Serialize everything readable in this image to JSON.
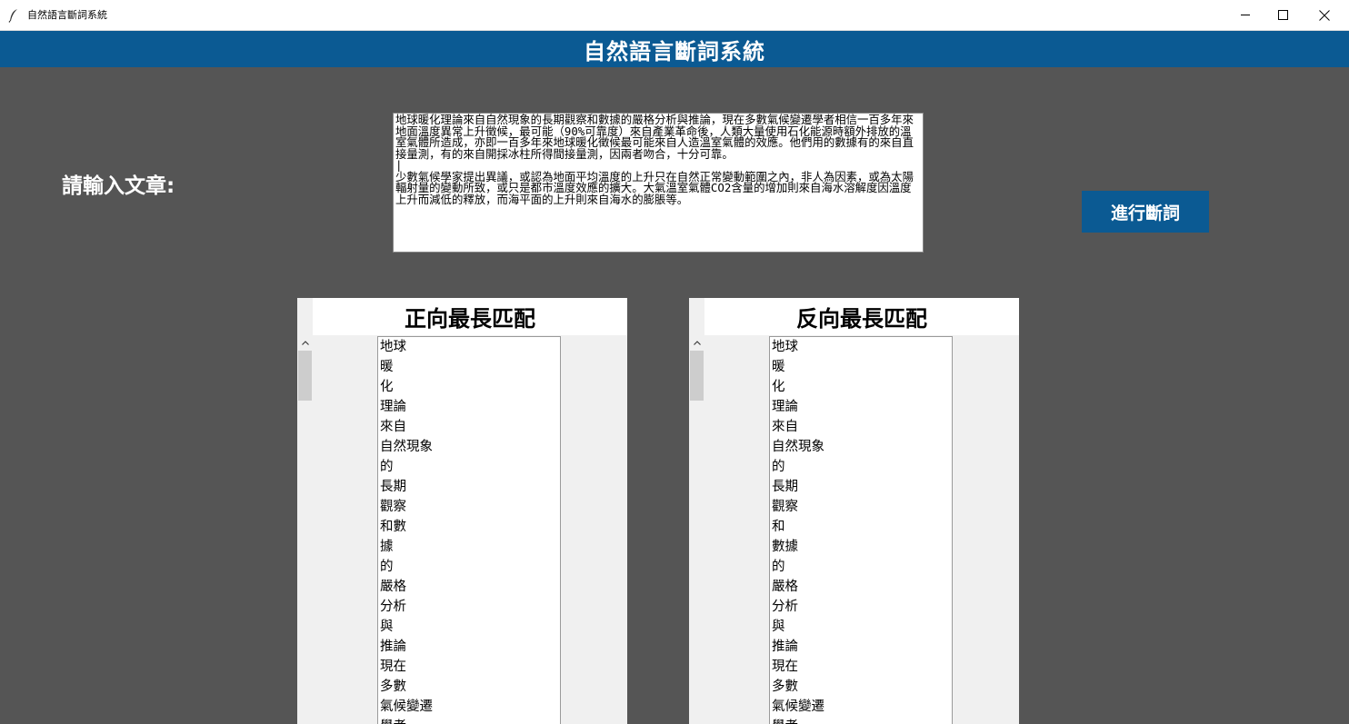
{
  "window": {
    "title": "自然語言斷詞系統"
  },
  "banner": {
    "title": "自然語言斷詞系統"
  },
  "input": {
    "label": "請輸入文章:",
    "paragraphs": [
      "地球暖化理論來自自然現象的長期觀察和數據的嚴格分析與推論，現在多數氣候變遷學者相信一百多年來地面溫度異常上升徵候，最可能（90%可靠度）來自產業革命後，人類大量使用石化能源時額外排放的溫室氣體所造成，亦即一百多年來地球暖化徵候最可能來自人造溫室氣體的效應。他們用的數據有的來自直接量測，有的來自開採冰柱所得間接量測，因兩者吻合，十分可靠。",
      "少數氣候學家提出異議，或認為地面平均溫度的上升只在自然正常變動範圍之內，非人為因素，或為太陽輻射量的變動所致，或只是都市溫度效應的擴大。大氣溫室氣體CO2含量的增加則來自海水溶解度因溫度上升而減低的釋放，而海平面的上升則來自海水的膨脹等。"
    ]
  },
  "actions": {
    "segment_label": "進行斷詞"
  },
  "forward": {
    "title": "正向最長匹配",
    "words": [
      "地球",
      "暖",
      "化",
      "理論",
      "來自",
      "自然現象",
      "的",
      "長期",
      "觀察",
      "和數",
      "據",
      "的",
      "嚴格",
      "分析",
      "與",
      "推論",
      "現在",
      "多數",
      "氣候變遷",
      "學者"
    ]
  },
  "backward": {
    "title": "反向最長匹配",
    "words": [
      "地球",
      "暖",
      "化",
      "理論",
      "來自",
      "自然現象",
      "的",
      "長期",
      "觀察",
      "和",
      "數據",
      "的",
      "嚴格",
      "分析",
      "與",
      "推論",
      "現在",
      "多數",
      "氣候變遷",
      "學者"
    ]
  },
  "colors": {
    "background": "#555555",
    "accent": "#0b5a93",
    "panel": "#f0f0f0"
  },
  "icons": {
    "app": "feather-icon",
    "minimize": "minimize-icon",
    "maximize": "maximize-icon",
    "close": "close-icon",
    "scroll_up": "chevron-up-icon"
  }
}
